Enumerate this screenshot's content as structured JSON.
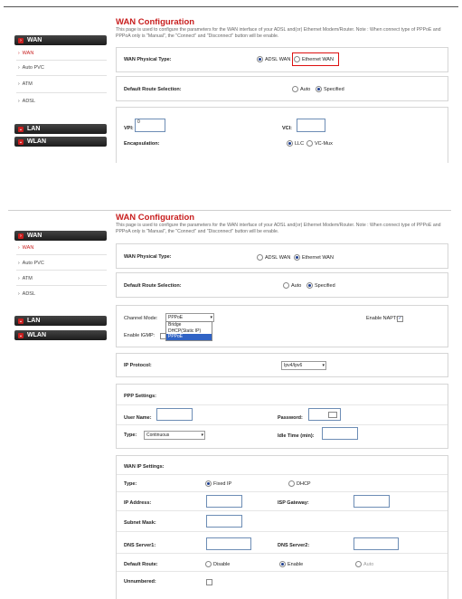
{
  "sidebar": {
    "wan": "WAN",
    "wan_sub": "WAN",
    "auto_pvc": "Auto PVC",
    "atm": "ATM",
    "adsl": "ADSL",
    "lan": "LAN",
    "wlan": "WLAN"
  },
  "header": {
    "title": "WAN Configuration",
    "desc": "This page is used to configure the parameters for the WAN interface of your ADSL and(or) Ethernet Modem/Router. Note : When connect type of PPPoE and PPPoA only is \"Manual\", the \"Connect\" and \"Disconnect\" button will be enable."
  },
  "screen1": {
    "physical_type_label": "WAN Physical Type:",
    "adsl_wan": "ADSL WAN",
    "ethernet_wan": "Ethernet WAN",
    "default_route_label": "Default Route Selection:",
    "auto": "Auto",
    "specified": "Specified",
    "vpi_label": "VPI:",
    "vpi_value": "0",
    "vci_label": "VCI:",
    "vci_value": "",
    "encapsulation_label": "Encapsulation:",
    "llc": "LLC",
    "vcmux": "VC-Mux"
  },
  "screen2": {
    "physical_type_label": "WAN Physical Type:",
    "adsl_wan": "ADSL WAN",
    "ethernet_wan": "Ethernet WAN",
    "default_route_label": "Default Route Selection:",
    "auto": "Auto",
    "specified": "Specified",
    "channel_mode_label": "Channel Mode:",
    "channel_mode_value": "PPPoE",
    "channel_options": [
      "Bridge",
      "DHCP(Static IP)",
      "PPPoE"
    ],
    "enable_napt_label": "Enable NAPT:",
    "enable_igmp_label": "Enable IGMP:",
    "ip_protocol_label": "IP Protocol:",
    "ip_protocol_value": "Ipv4/Ipv6",
    "ppp_settings_label": "PPP Settings:",
    "username_label": "User Name:",
    "password_label": "Password:",
    "type_label": "Type:",
    "type_value": "Continuous",
    "idle_time_label": "Idle Time (min):",
    "wan_ip_settings_label": "WAN IP Settings:",
    "type2_label": "Type:",
    "fixed_ip": "Fixed IP",
    "dhcp": "DHCP",
    "ip_address_label": "IP Address:",
    "isp_gateway_label": "ISP Gateway:",
    "subnet_mask_label": "Subnet Mask:",
    "dns1_label": "DNS Server1:",
    "dns2_label": "DNS Server2:",
    "default_route2_label": "Default Route:",
    "disable": "Disable",
    "enable": "Enable",
    "auto2": "Auto",
    "unnumbered_label": "Unnumbered:"
  }
}
